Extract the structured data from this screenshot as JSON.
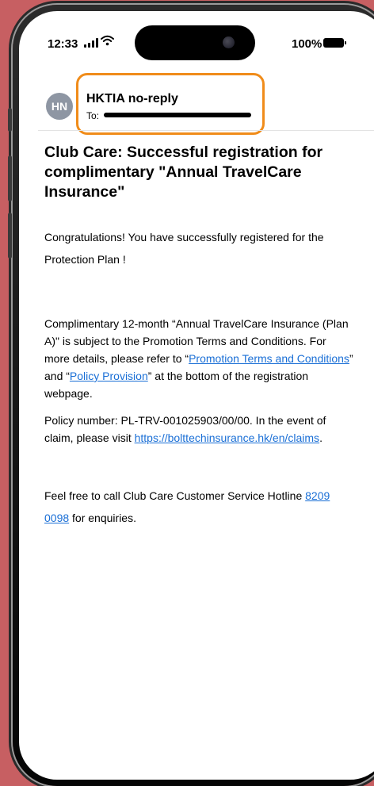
{
  "status_bar": {
    "time": "12:33",
    "battery": "100%"
  },
  "email": {
    "avatar_initials": "HN",
    "sender": "HKTIA no-reply",
    "to_label": "To:",
    "subject": "Club Care: Successful registration for complimentary \"Annual TravelCare Insurance\"",
    "para1": "Congratulations! You have successfully registered for the Protection Plan !",
    "para2": {
      "text1": "Complimentary 12-month “Annual TravelCare Insurance (Plan A)\" is subject to the Promotion Terms and Conditions. For more details, please refer to “",
      "link1": "Promotion Terms and Conditions",
      "text2": "” and “",
      "link2": "Policy Provision",
      "text3": "” at the bottom of the registration webpage."
    },
    "para3": {
      "text1": "Policy number: PL-TRV-001025903/00/00. In the event of claim, please visit ",
      "link": "https://bolttechinsurance.hk/en/claims",
      "text2": "."
    },
    "para4": {
      "text1": "Feel free to call Club Care Customer Service Hotline ",
      "link": "8209 0098",
      "text2": " for enquiries."
    }
  },
  "colors": {
    "background": "#c75f62",
    "highlight": "#f08c1a",
    "link": "#1a6fd6",
    "avatar": "#8e96a3"
  }
}
